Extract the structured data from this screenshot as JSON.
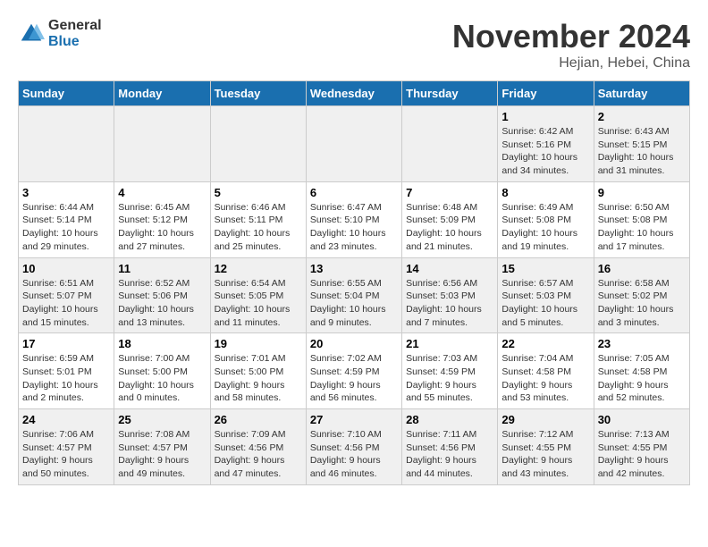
{
  "logo": {
    "general": "General",
    "blue": "Blue"
  },
  "header": {
    "month": "November 2024",
    "location": "Hejian, Hebei, China"
  },
  "weekdays": [
    "Sunday",
    "Monday",
    "Tuesday",
    "Wednesday",
    "Thursday",
    "Friday",
    "Saturday"
  ],
  "weeks": [
    [
      {
        "day": "",
        "info": ""
      },
      {
        "day": "",
        "info": ""
      },
      {
        "day": "",
        "info": ""
      },
      {
        "day": "",
        "info": ""
      },
      {
        "day": "",
        "info": ""
      },
      {
        "day": "1",
        "info": "Sunrise: 6:42 AM\nSunset: 5:16 PM\nDaylight: 10 hours and 34 minutes."
      },
      {
        "day": "2",
        "info": "Sunrise: 6:43 AM\nSunset: 5:15 PM\nDaylight: 10 hours and 31 minutes."
      }
    ],
    [
      {
        "day": "3",
        "info": "Sunrise: 6:44 AM\nSunset: 5:14 PM\nDaylight: 10 hours and 29 minutes."
      },
      {
        "day": "4",
        "info": "Sunrise: 6:45 AM\nSunset: 5:12 PM\nDaylight: 10 hours and 27 minutes."
      },
      {
        "day": "5",
        "info": "Sunrise: 6:46 AM\nSunset: 5:11 PM\nDaylight: 10 hours and 25 minutes."
      },
      {
        "day": "6",
        "info": "Sunrise: 6:47 AM\nSunset: 5:10 PM\nDaylight: 10 hours and 23 minutes."
      },
      {
        "day": "7",
        "info": "Sunrise: 6:48 AM\nSunset: 5:09 PM\nDaylight: 10 hours and 21 minutes."
      },
      {
        "day": "8",
        "info": "Sunrise: 6:49 AM\nSunset: 5:08 PM\nDaylight: 10 hours and 19 minutes."
      },
      {
        "day": "9",
        "info": "Sunrise: 6:50 AM\nSunset: 5:08 PM\nDaylight: 10 hours and 17 minutes."
      }
    ],
    [
      {
        "day": "10",
        "info": "Sunrise: 6:51 AM\nSunset: 5:07 PM\nDaylight: 10 hours and 15 minutes."
      },
      {
        "day": "11",
        "info": "Sunrise: 6:52 AM\nSunset: 5:06 PM\nDaylight: 10 hours and 13 minutes."
      },
      {
        "day": "12",
        "info": "Sunrise: 6:54 AM\nSunset: 5:05 PM\nDaylight: 10 hours and 11 minutes."
      },
      {
        "day": "13",
        "info": "Sunrise: 6:55 AM\nSunset: 5:04 PM\nDaylight: 10 hours and 9 minutes."
      },
      {
        "day": "14",
        "info": "Sunrise: 6:56 AM\nSunset: 5:03 PM\nDaylight: 10 hours and 7 minutes."
      },
      {
        "day": "15",
        "info": "Sunrise: 6:57 AM\nSunset: 5:03 PM\nDaylight: 10 hours and 5 minutes."
      },
      {
        "day": "16",
        "info": "Sunrise: 6:58 AM\nSunset: 5:02 PM\nDaylight: 10 hours and 3 minutes."
      }
    ],
    [
      {
        "day": "17",
        "info": "Sunrise: 6:59 AM\nSunset: 5:01 PM\nDaylight: 10 hours and 2 minutes."
      },
      {
        "day": "18",
        "info": "Sunrise: 7:00 AM\nSunset: 5:00 PM\nDaylight: 10 hours and 0 minutes."
      },
      {
        "day": "19",
        "info": "Sunrise: 7:01 AM\nSunset: 5:00 PM\nDaylight: 9 hours and 58 minutes."
      },
      {
        "day": "20",
        "info": "Sunrise: 7:02 AM\nSunset: 4:59 PM\nDaylight: 9 hours and 56 minutes."
      },
      {
        "day": "21",
        "info": "Sunrise: 7:03 AM\nSunset: 4:59 PM\nDaylight: 9 hours and 55 minutes."
      },
      {
        "day": "22",
        "info": "Sunrise: 7:04 AM\nSunset: 4:58 PM\nDaylight: 9 hours and 53 minutes."
      },
      {
        "day": "23",
        "info": "Sunrise: 7:05 AM\nSunset: 4:58 PM\nDaylight: 9 hours and 52 minutes."
      }
    ],
    [
      {
        "day": "24",
        "info": "Sunrise: 7:06 AM\nSunset: 4:57 PM\nDaylight: 9 hours and 50 minutes."
      },
      {
        "day": "25",
        "info": "Sunrise: 7:08 AM\nSunset: 4:57 PM\nDaylight: 9 hours and 49 minutes."
      },
      {
        "day": "26",
        "info": "Sunrise: 7:09 AM\nSunset: 4:56 PM\nDaylight: 9 hours and 47 minutes."
      },
      {
        "day": "27",
        "info": "Sunrise: 7:10 AM\nSunset: 4:56 PM\nDaylight: 9 hours and 46 minutes."
      },
      {
        "day": "28",
        "info": "Sunrise: 7:11 AM\nSunset: 4:56 PM\nDaylight: 9 hours and 44 minutes."
      },
      {
        "day": "29",
        "info": "Sunrise: 7:12 AM\nSunset: 4:55 PM\nDaylight: 9 hours and 43 minutes."
      },
      {
        "day": "30",
        "info": "Sunrise: 7:13 AM\nSunset: 4:55 PM\nDaylight: 9 hours and 42 minutes."
      }
    ]
  ]
}
